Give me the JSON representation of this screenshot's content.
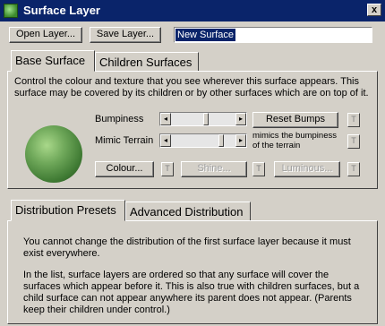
{
  "window": {
    "title": "Surface Layer",
    "close_label": "x"
  },
  "toolbar": {
    "open_label": "Open Layer...",
    "save_label": "Save Layer...",
    "surface_name": "New Surface"
  },
  "top_tabs": [
    {
      "label": "Base Surface",
      "active": true
    },
    {
      "label": "Children Surfaces",
      "active": false
    }
  ],
  "base_surface": {
    "description": "Control the colour and texture that you see wherever this surface appears. This surface may be covered by its children or by other surfaces which are on top of it.",
    "bumpiness": {
      "label": "Bumpiness",
      "value_fraction": 0.55,
      "reset_label": "Reset Bumps",
      "t_label": "T"
    },
    "mimic_terrain": {
      "label": "Mimic Terrain",
      "value_fraction": 0.8,
      "note": "mimics the bumpiness of the terrain",
      "t_label": "T"
    },
    "colour_label": "Colour...",
    "shine_label": "Shine...",
    "luminous_label": "Luminous...",
    "t_label": "T"
  },
  "bottom_tabs": [
    {
      "label": "Distribution Presets",
      "active": true
    },
    {
      "label": "Advanced Distribution",
      "active": false
    }
  ],
  "distribution": {
    "para1": "You cannot change the distribution of the first surface layer because it must exist everywhere.",
    "para2": "In the list, surface layers are ordered so that any surface will cover the surfaces which appear before it. This is also true with children surfaces, but a child surface can not appear anywhere its parent does not appear. (Parents keep their children under control.)"
  },
  "colors": {
    "title_bar": "#0a246a",
    "face": "#d4d0c8",
    "selection": "#0a246a",
    "sphere": "#6fa85a"
  },
  "icons": {
    "app": "planet-icon",
    "left_arrow": "◂",
    "right_arrow": "▸"
  }
}
